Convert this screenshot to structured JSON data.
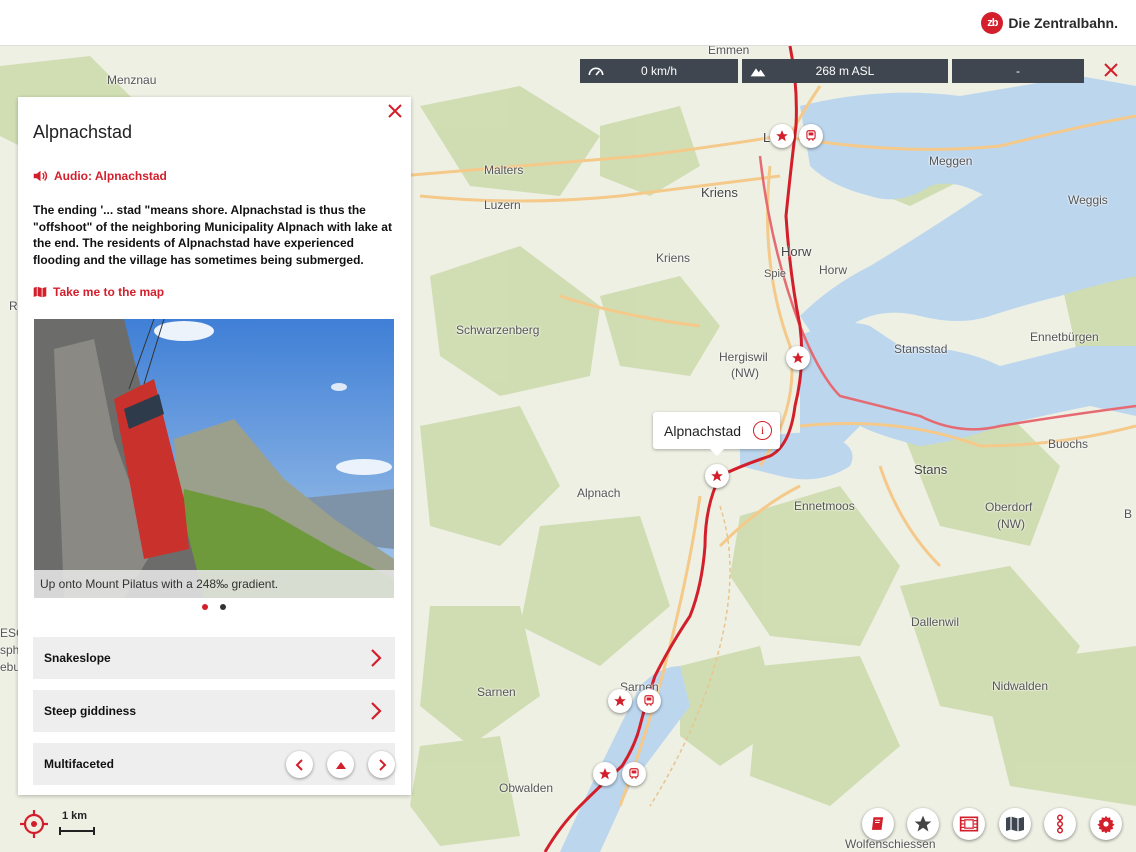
{
  "header": {
    "brand_logo_text": "zb",
    "brand_name": "Die Zentralbahn."
  },
  "infobar": {
    "speed": "0 km/h",
    "altitude": "268 m ASL",
    "third": "-"
  },
  "panel": {
    "title": "Alpnachstad",
    "audio_label": "Audio: Alpnachstad",
    "description": "The ending '... stad \"means shore. Alpnachstad is thus the \"offshoot\" of the neighboring Municipality Alpnach with lake at the end. The residents of Alpnachstad have experienced flooding and the village has sometimes being submerged.",
    "map_link_label": "Take me to the map",
    "photo_caption": "Up onto Mount Pilatus with a 248‰ gradient.",
    "carousel_total": 2,
    "carousel_active": 1,
    "rows": [
      {
        "label": "Snakeslope"
      },
      {
        "label": "Steep giddiness"
      },
      {
        "label": "Multifaceted"
      }
    ]
  },
  "map": {
    "callout_label": "Alpnachstad",
    "scale_label": "1 km",
    "places": [
      {
        "name": "Emmen"
      },
      {
        "name": "Menznau"
      },
      {
        "name": "Lu"
      },
      {
        "name": "Meggen"
      },
      {
        "name": "Malters"
      },
      {
        "name": "Kriens"
      },
      {
        "name": "Luzern"
      },
      {
        "name": "Weggis"
      },
      {
        "name": "Horw"
      },
      {
        "name": "Horw"
      },
      {
        "name": "Kriens"
      },
      {
        "name": "Spie"
      },
      {
        "name": "Schwarzenberg"
      },
      {
        "name": "Ennetbürgen"
      },
      {
        "name": "Hergiswil"
      },
      {
        "name": "(NW)"
      },
      {
        "name": "Stansstad"
      },
      {
        "name": "Buochs"
      },
      {
        "name": "Stans"
      },
      {
        "name": "Alpnach"
      },
      {
        "name": "Ennetmoos"
      },
      {
        "name": "Oberdorf"
      },
      {
        "name": "(NW)"
      },
      {
        "name": "Dallenwil"
      },
      {
        "name": "Sarnen"
      },
      {
        "name": "Sarnen"
      },
      {
        "name": "Nidwalden"
      },
      {
        "name": "Obwalden"
      },
      {
        "name": "Wolfenschiessen"
      },
      {
        "name": "R"
      },
      {
        "name": "ESC"
      },
      {
        "name": "sph"
      },
      {
        "name": "ebu"
      },
      {
        "name": "B"
      }
    ]
  },
  "colors": {
    "accent": "#d31f2b",
    "lake": "#bcd6ee",
    "forest": "#cfdcb0",
    "infobar": "#3f4650"
  },
  "icons": {
    "speed": "speedometer-icon",
    "altitude": "mountain-icon",
    "audio": "speaker-icon",
    "map_link": "map-icon",
    "pin_star": "star-icon",
    "pin_station": "train-icon",
    "fabs": [
      "book-icon",
      "star-icon",
      "film-icon",
      "map-icon",
      "route-icon",
      "gear-icon"
    ]
  }
}
